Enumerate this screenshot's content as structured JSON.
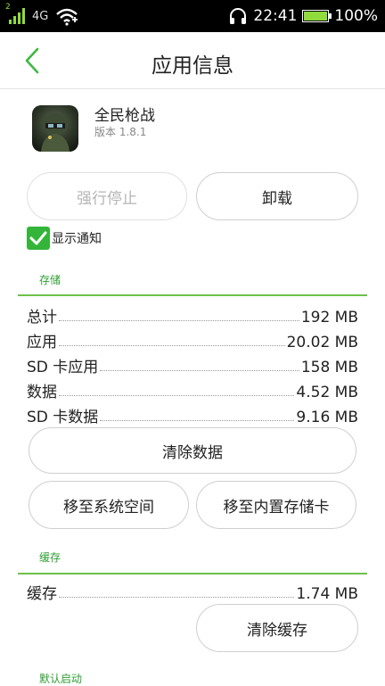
{
  "status_bar": {
    "sim_slot": "2",
    "network": "4G",
    "time": "22:41",
    "battery": "100%",
    "battery_level": 1.0
  },
  "header": {
    "title": "应用信息"
  },
  "app": {
    "name": "全民枪战",
    "version": "版本 1.8.1"
  },
  "actions": {
    "force_stop": "强行停止",
    "uninstall": "卸载"
  },
  "notifications": {
    "label": "显示通知",
    "checked": true
  },
  "storage": {
    "section_label": "存储",
    "rows": [
      {
        "label": "总计",
        "value": "192 MB"
      },
      {
        "label": "应用",
        "value": "20.02 MB"
      },
      {
        "label": "SD 卡应用",
        "value": "158 MB"
      },
      {
        "label": "数据",
        "value": "4.52 MB"
      },
      {
        "label": "SD 卡数据",
        "value": "9.16 MB"
      }
    ],
    "clear_data": "清除数据",
    "move_to_system": "移至系统空间",
    "move_to_internal_sd": "移至内置存储卡"
  },
  "cache": {
    "section_label": "缓存",
    "row": {
      "label": "缓存",
      "value": "1.74 MB"
    },
    "clear_cache": "清除缓存"
  },
  "default_launch": {
    "section_label": "默认启动"
  },
  "colors": {
    "accent": "#34b53a",
    "section_line": "#6cc24a",
    "section_text": "#2e9e33"
  }
}
